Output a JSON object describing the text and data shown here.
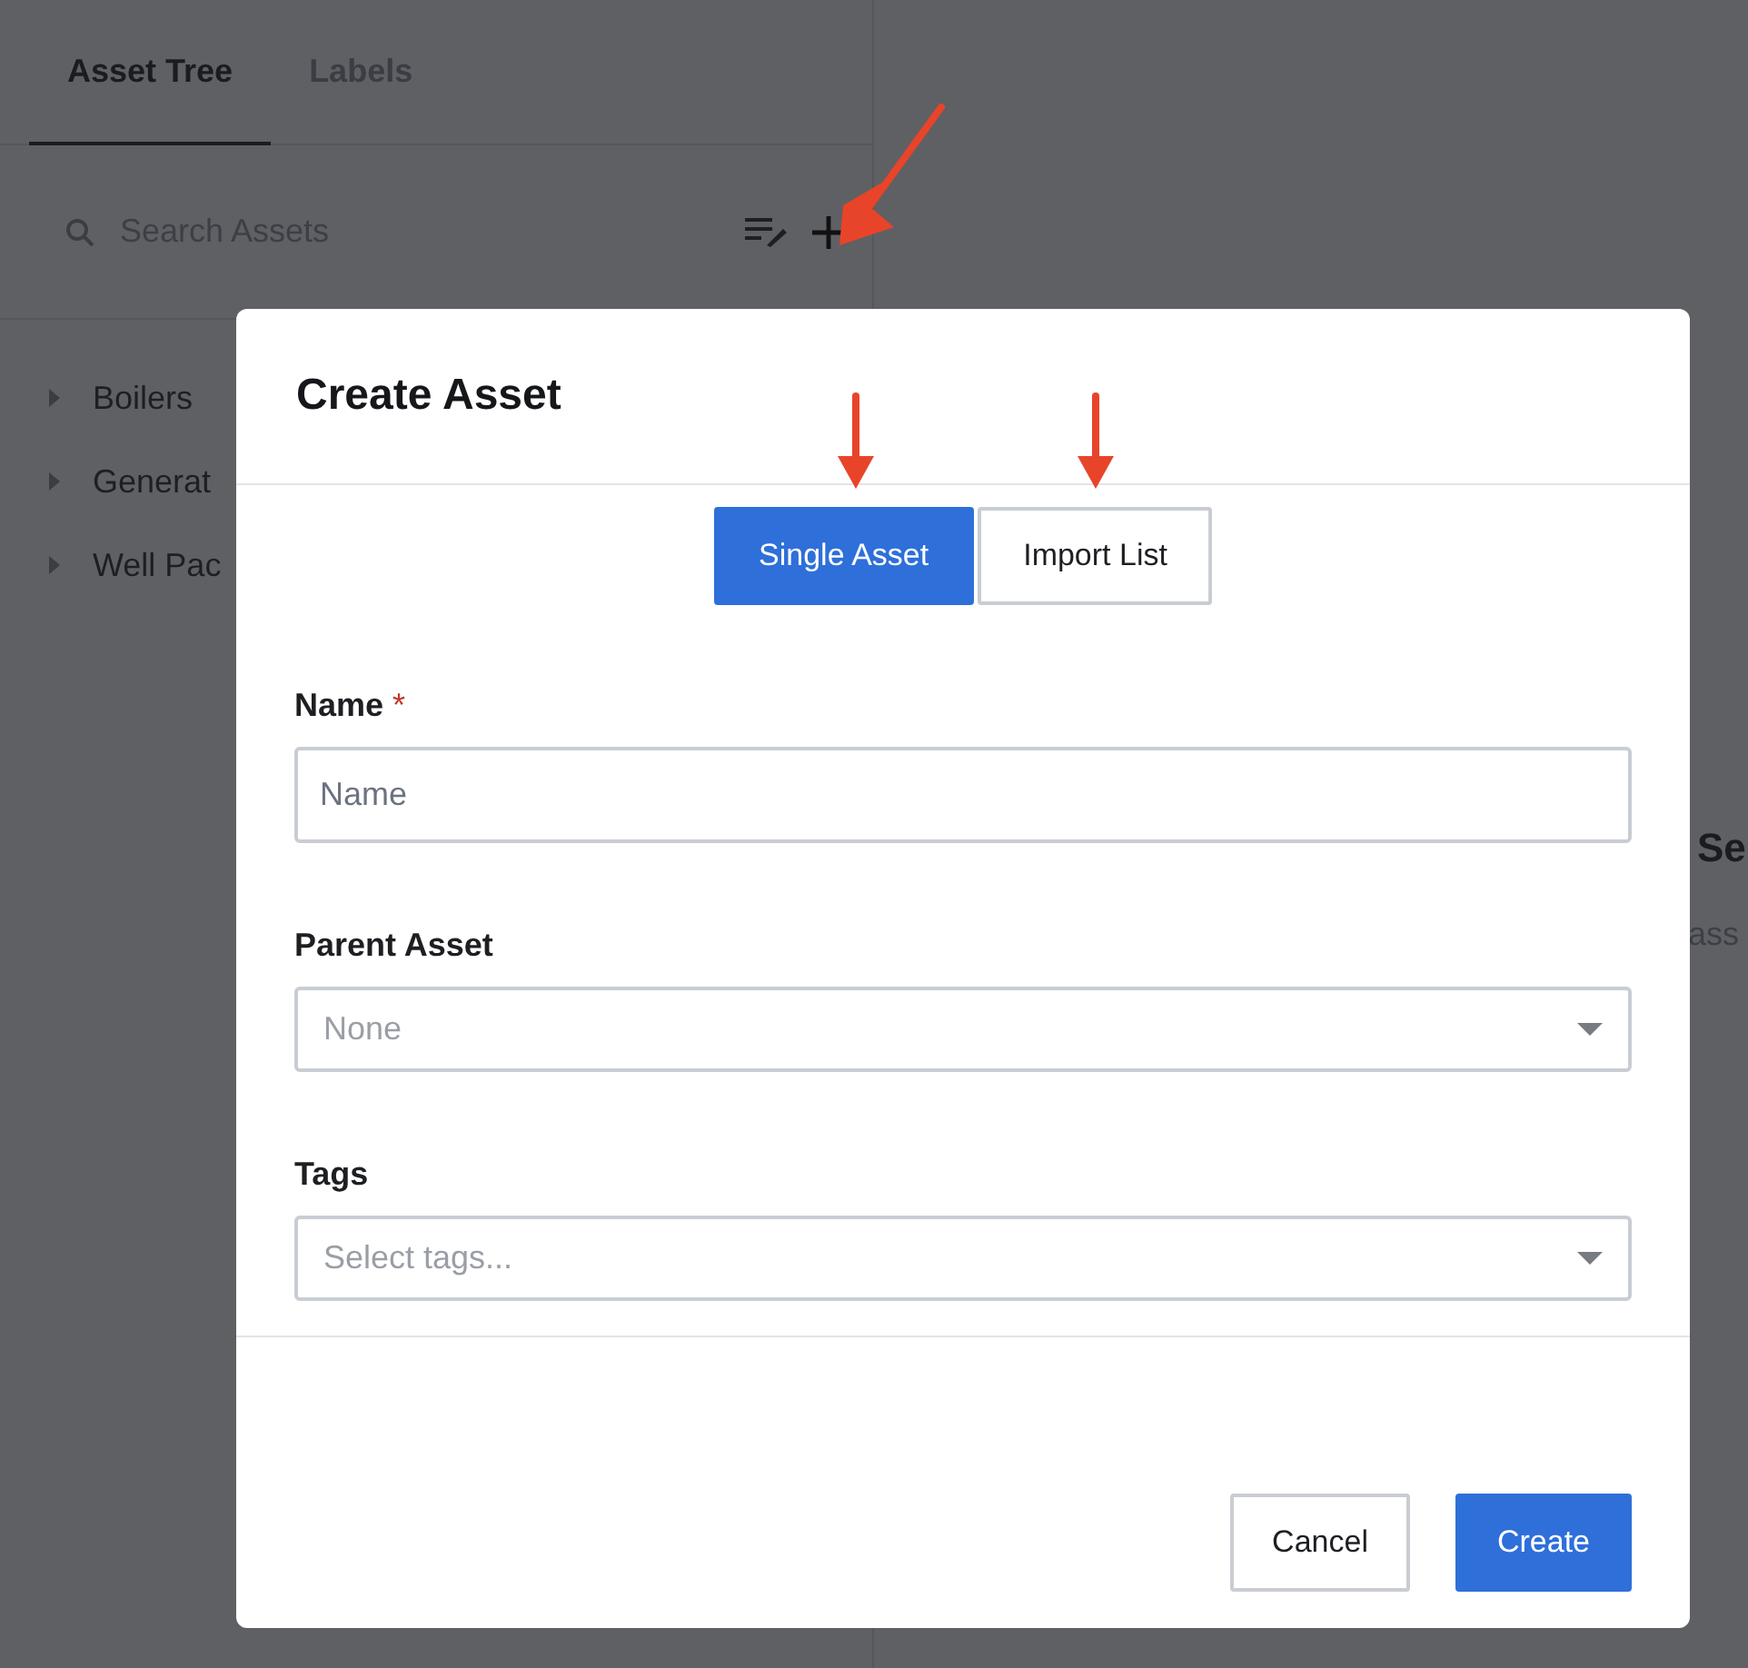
{
  "sidebar": {
    "tabs": [
      {
        "label": "Asset Tree",
        "selected": true
      },
      {
        "label": "Labels",
        "selected": false
      }
    ],
    "search": {
      "placeholder": "Search Assets"
    },
    "tree": [
      {
        "label": "Boilers",
        "expanded": false
      },
      {
        "label": "Generat",
        "expanded": false
      },
      {
        "label": "Well Pac",
        "expanded": false
      }
    ]
  },
  "main": {
    "heading": "Se",
    "subtext": "ass"
  },
  "dialog": {
    "title": "Create Asset",
    "modes": [
      {
        "label": "Single Asset",
        "selected": true
      },
      {
        "label": "Import List",
        "selected": false
      }
    ],
    "fields": [
      {
        "label": "Name",
        "required_mark": "*",
        "kind": "text",
        "placeholder": "Name"
      },
      {
        "label": "Parent Asset",
        "kind": "select",
        "placeholder": "None"
      },
      {
        "label": "Tags",
        "kind": "select",
        "placeholder": "Select tags..."
      }
    ],
    "buttons": [
      {
        "label": "Cancel",
        "kind": "secondary"
      },
      {
        "label": "Create",
        "kind": "primary"
      }
    ]
  }
}
